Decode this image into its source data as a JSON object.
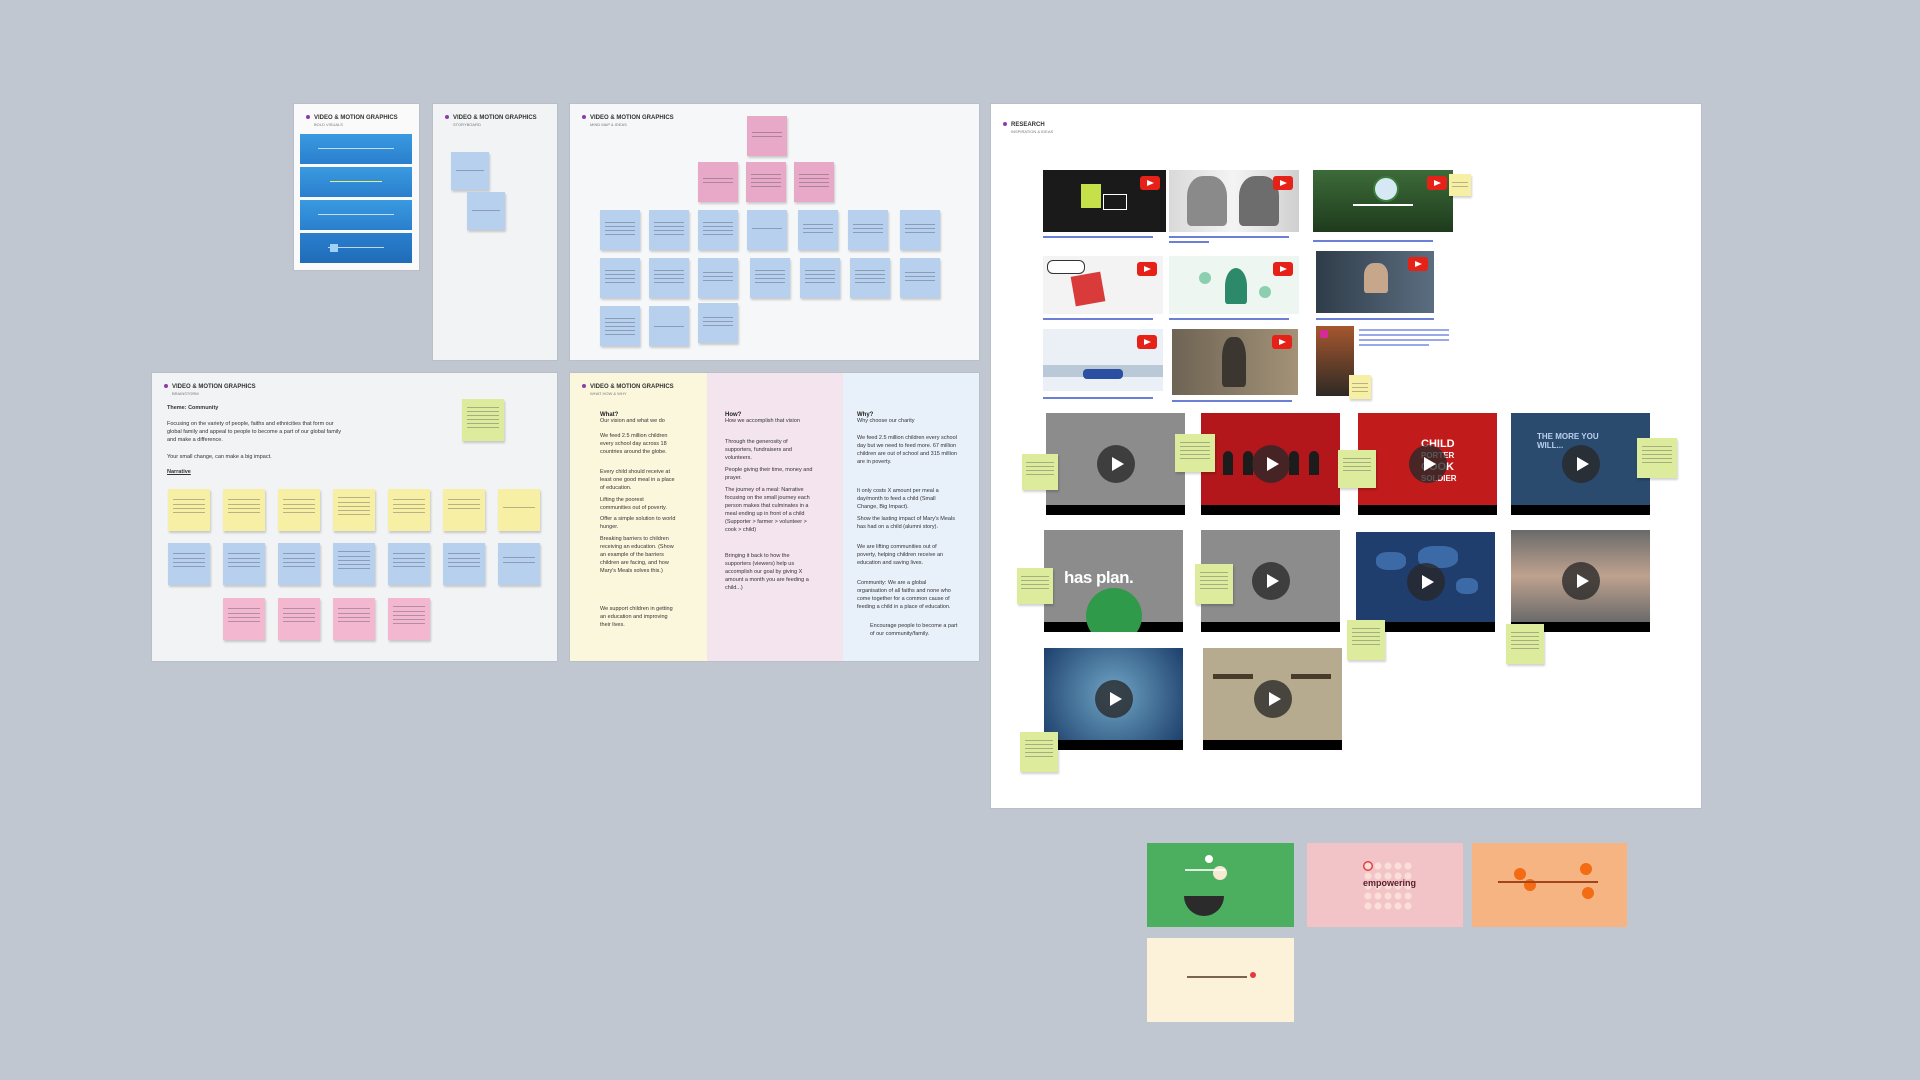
{
  "canvas": {
    "background": "#c1c7d1"
  },
  "frames": {
    "slides": {
      "title": "VIDEO & MOTION GRAPHICS",
      "subtitle": "BOLD VISUALS"
    },
    "storyboard": {
      "title": "VIDEO & MOTION GRAPHICS",
      "subtitle": "STORYBOARD"
    },
    "mindmap": {
      "title": "VIDEO & MOTION GRAPHICS",
      "subtitle": "MIND MAP & IDEAS"
    },
    "narrative": {
      "title": "VIDEO & MOTION GRAPHICS",
      "subtitle": "BRAINSTORM",
      "theme": "Theme: Community",
      "body": "Focusing on the variety of people, faiths and ethnicities that form our global family and appeal to people to become a part of our global family and make a difference.",
      "tagline": "Your small change, can make a big impact.",
      "narrative_label": "Narrative"
    },
    "whathowwhy": {
      "title": "VIDEO & MOTION GRAPHICS",
      "subtitle": "WHAT HOW & WHY",
      "what_head": "What?",
      "what_sub": "Our vision and what we do",
      "what_p1": "We feed 2.5 million children every school day across 18 countries around the globe.",
      "what_p2": "Every child should receive at least one good meal in a place of education.",
      "what_p3": "Lifting the poorest communities out of poverty.",
      "what_p4": "Offer a simple solution to world hunger.",
      "what_p5": "Breaking barriers to children receiving an education. (Show an example of the barriers children are facing, and how Mary's Meals solves this.)",
      "what_p6": "We support children in getting an education and improving their lives.",
      "how_head": "How?",
      "how_sub": "How we accomplish that vision",
      "how_p1": "Through the generosity of supporters, fundraisers and volunteers.",
      "how_p2": "People giving their time, money and prayer.",
      "how_p3": "The journey of a meal: Narrative focusing on the small journey each person makes that culminates in a meal ending up in front of a child (Supporter > farmer > volunteer > cook > child)",
      "how_p4": "Bringing it back to how the supporters (viewers) help us accomplish our goal by giving X amount a month you are feeding a child...)",
      "why_head": "Why?",
      "why_sub": "Why choose our charity",
      "why_p1": "We feed 2.5 million children every school day but we need to feed more. 67 million children are out of school and 315 million are in poverty.",
      "why_p2": "It only costs X amount per meal a day/month to feed a child (Small Change, Big Impact).",
      "why_p3": "Show the lasting impact of Mary's Meals has had on a child (alumni story).",
      "why_p4": "We are lifting communities out of poverty, helping children receive an education and saving lives.",
      "why_p5": "Community: We are a global organisation of all faiths and none who come together for a common cause of feeding a child in a place of education.",
      "why_p6": "Encourage people to become a part of our community/family."
    },
    "research": {
      "title": "RESEARCH",
      "subtitle": "INSPIRATION & IDEAS"
    }
  },
  "video_thumbs": {
    "has_plan": "has plan.",
    "child": "CHILD",
    "porter": "PORTER",
    "cook": "COOK",
    "soldier": "SOLDIER",
    "more_you": "THE MORE YOU WILL..."
  },
  "animation_cards": {
    "empowering": "empowering"
  },
  "colors": {
    "blue_sticky": "#b7d0ee",
    "pink_sticky": "#e8a8c7",
    "yellow_sticky": "#f7f0a4",
    "lime_sticky": "#dcec9c",
    "slide_blue": "#2f8bd6",
    "youtube_red": "#e62117",
    "green_card": "#4caf60",
    "pink_card": "#f2c4c8",
    "orange_card": "#f6b483",
    "cream_card": "#fbf2d9"
  }
}
